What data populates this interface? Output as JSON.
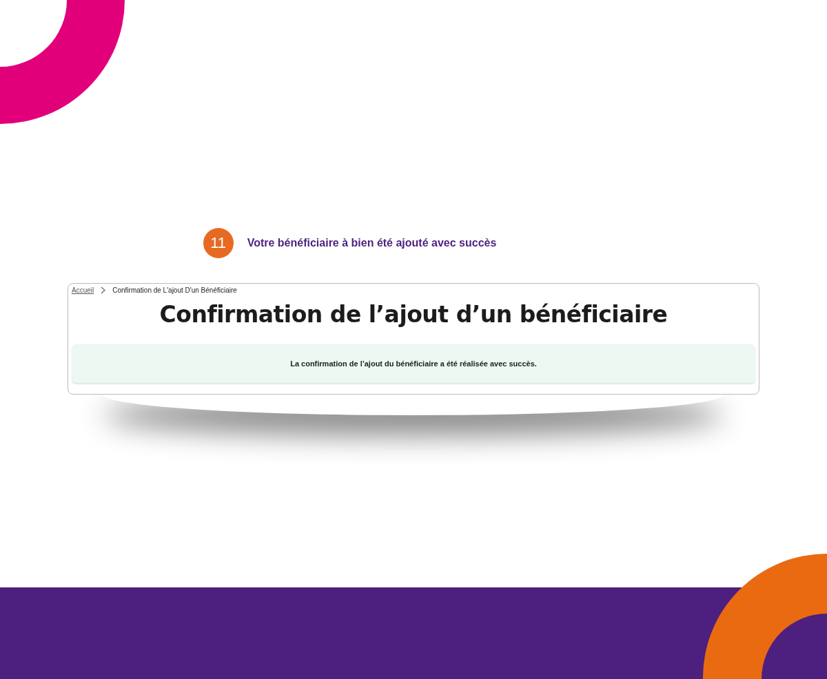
{
  "step": {
    "number": "11",
    "caption": "Votre bénéficiaire à bien été ajouté avec succès"
  },
  "breadcrumb": [
    {
      "label": "Accueil",
      "kind": "link"
    },
    {
      "label": "Confirmation de L'ajout D'un Bénéficiaire",
      "kind": "current"
    }
  ],
  "page_title": "Confirmation de l’ajout d’un bénéficiaire",
  "alert": {
    "message": "La confirmation de l’ajout du bénéficiaire a été réalisée avec succès."
  }
}
